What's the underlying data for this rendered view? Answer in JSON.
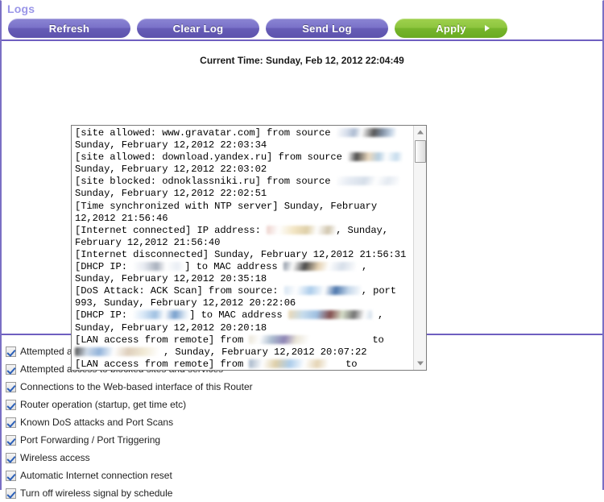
{
  "page": {
    "title": "Logs",
    "accent_purple": "#6f5fc0",
    "title_color": "#9a96e8",
    "apply_green": "#8ec63f"
  },
  "toolbar": {
    "refresh_label": "Refresh",
    "clear_log_label": "Clear Log",
    "send_log_label": "Send Log",
    "apply_label": "Apply"
  },
  "log": {
    "current_time_label": "Current Time: Sunday, Feb 12, 2012 22:04:49",
    "lines": [
      {
        "pre": "[site allowed: www.gravatar.com] from source ",
        "redact": "a",
        "post": ""
      },
      {
        "pre": "Sunday, February 12,2012 22:03:34",
        "redact": "",
        "post": ""
      },
      {
        "pre": "[site allowed: download.yandex.ru] from source ",
        "redact": "b",
        "post": ""
      },
      {
        "pre": "Sunday, February 12,2012 22:03:02",
        "redact": "",
        "post": ""
      },
      {
        "pre": "[site blocked: odnoklassniki.ru] from source ",
        "redact": "c",
        "post": ""
      },
      {
        "pre": "Sunday, February 12,2012 22:02:51",
        "redact": "",
        "post": ""
      },
      {
        "pre": "[Time synchronized with NTP server] Sunday, February",
        "redact": "",
        "post": ""
      },
      {
        "pre": "12,2012 21:56:46",
        "redact": "",
        "post": ""
      },
      {
        "pre": "[Internet connected] IP address: ",
        "redact": "d",
        "post": ", Sunday,"
      },
      {
        "pre": "February 12,2012 21:56:40",
        "redact": "",
        "post": ""
      },
      {
        "pre": "[Internet disconnected] Sunday, February 12,2012 21:56:31",
        "redact": "",
        "post": ""
      },
      {
        "pre": "[DHCP IP: ",
        "redact": "e",
        "post": "] to MAC address "
      },
      {
        "pre": "Sunday, February 12,2012 20:35:18",
        "redact": "",
        "post": ""
      },
      {
        "pre": "[DoS Attack: ACK Scan] from source: ",
        "redact": "g",
        "post": ", port"
      },
      {
        "pre": "993, Sunday, February 12,2012 20:22:06",
        "redact": "",
        "post": ""
      },
      {
        "pre": "[DHCP IP: ",
        "redact": "h",
        "post": "] to MAC address "
      },
      {
        "pre": "Sunday, February 12,2012 20:20:18",
        "redact": "",
        "post": ""
      },
      {
        "pre": "[LAN access from remote] from ",
        "redact": "j",
        "post": "         to"
      },
      {
        "pre": "",
        "redact": "k",
        "post": ", Sunday, February 12,2012 20:07:22"
      },
      {
        "pre": "[LAN access from remote] from ",
        "redact": "l",
        "post": "   to"
      }
    ]
  },
  "options": [
    {
      "label": "Attempted access to allowed sites",
      "checked": true
    },
    {
      "label": "Attempted access to blocked sites and services",
      "checked": true
    },
    {
      "label": "Connections to the Web-based interface of this Router",
      "checked": true
    },
    {
      "label": "Router operation (startup, get time etc)",
      "checked": true
    },
    {
      "label": "Known DoS attacks and Port Scans",
      "checked": true
    },
    {
      "label": "Port Forwarding / Port Triggering",
      "checked": true
    },
    {
      "label": "Wireless access",
      "checked": true
    },
    {
      "label": "Automatic Internet connection reset",
      "checked": true
    },
    {
      "label": "Turn off wireless signal by schedule",
      "checked": true
    }
  ]
}
